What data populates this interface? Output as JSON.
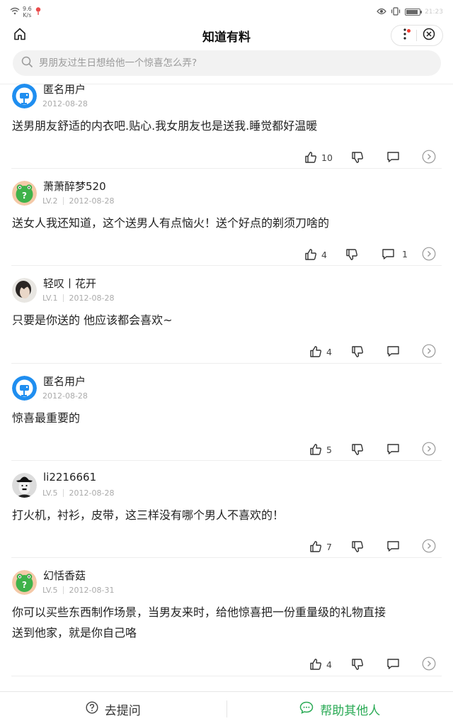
{
  "status_bar": {
    "speed_value": "9.6",
    "speed_unit": "K/s",
    "time": "21:23",
    "battery_level": 0.9
  },
  "header": {
    "title": "知道有料"
  },
  "search": {
    "placeholder": "男朋友过生日想给他一个惊喜怎么弄?"
  },
  "answers": [
    {
      "user": "匿名用户",
      "level": "",
      "date": "2012-08-28",
      "avatar": "anonymous-avatar",
      "text": "送男朋友舒适的内衣吧.贴心.我女朋友也是送我.睡觉都好温暖",
      "likes": "10",
      "comments": ""
    },
    {
      "user": "萧萧醉梦520",
      "level": "LV.2",
      "date": "2012-08-28",
      "avatar": "frog-avatar",
      "text": "送女人我还知道，这个送男人有点恼火！送个好点的剃须刀啥的",
      "likes": "4",
      "comments": "1"
    },
    {
      "user": "轻叹丨花开",
      "level": "LV.1",
      "date": "2012-08-28",
      "avatar": "photo-avatar",
      "text": "只要是你送的 他应该都会喜欢~",
      "likes": "4",
      "comments": ""
    },
    {
      "user": "匿名用户",
      "level": "",
      "date": "2012-08-28",
      "avatar": "anonymous-avatar",
      "text": "惊喜最重要的",
      "likes": "5",
      "comments": ""
    },
    {
      "user": "li2216661",
      "level": "LV.5",
      "date": "2012-08-28",
      "avatar": "chaplin-avatar",
      "text": "打火机，衬衫，皮带，这三样没有哪个男人不喜欢的！",
      "likes": "7",
      "comments": ""
    },
    {
      "user": "幻恬香菇",
      "level": "LV.5",
      "date": "2012-08-31",
      "avatar": "frog-avatar",
      "text_lines": [
        "你可以买些东西制作场景，当男友来时，给他惊喜把一份重量级的礼物直接",
        "送到他家，就是你自己咯"
      ],
      "likes": "4",
      "comments": ""
    }
  ],
  "bottom_bar": {
    "ask_label": "去提问",
    "help_label": "帮助其他人"
  },
  "colors": {
    "accent_green": "#2aaa55",
    "anon_avatar_blue": "#1f8ef0",
    "frog_green": "#3fb24a",
    "notification_red": "#f23b30"
  }
}
